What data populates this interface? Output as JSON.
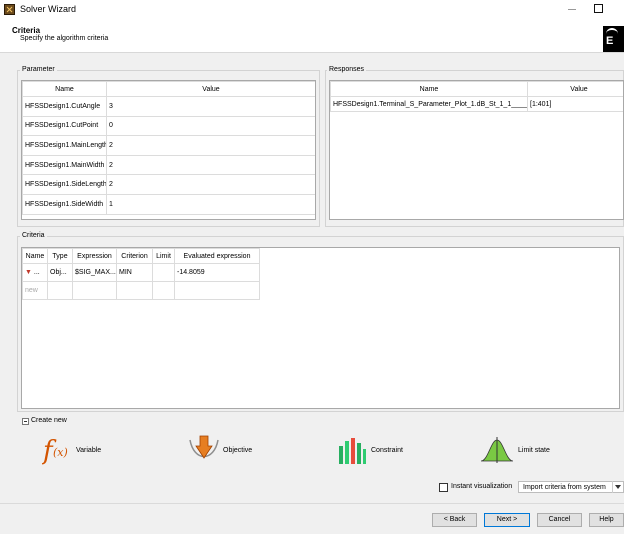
{
  "window": {
    "title": "Solver Wizard"
  },
  "header": {
    "title": "Criteria",
    "subtitle": "Specify the algorithm criteria",
    "logo_text": "E"
  },
  "parameters": {
    "group_title": "Parameter",
    "columns": [
      "Name",
      "Value"
    ],
    "rows": [
      [
        "HFSSDesign1.CutAngle",
        "3"
      ],
      [
        "HFSSDesign1.CutPoint",
        "0"
      ],
      [
        "HFSSDesign1.MainLength",
        "2"
      ],
      [
        "HFSSDesign1.MainWidth",
        "2"
      ],
      [
        "HFSSDesign1.SideLength",
        "2"
      ],
      [
        "HFSSDesign1.SideWidth",
        "1"
      ]
    ]
  },
  "responses": {
    "group_title": "Responses",
    "columns": [
      "Name",
      "Value"
    ],
    "rows": [
      [
        "HFSSDesign1.Terminal_S_Parameter_Plot_1.dB_St_1_1_____",
        "[1:401]"
      ]
    ]
  },
  "criteria": {
    "group_title": "Criteria",
    "columns": [
      "Name",
      "Type",
      "Expression",
      "Criterion",
      "Limit",
      "Evaluated expression"
    ],
    "rows": [
      {
        "name": "...",
        "type": "Obj...",
        "expression": "$SIG_MAX...",
        "criterion": "MIN",
        "limit": "",
        "evaluated": "-14.8059"
      }
    ],
    "new_row_label": "new"
  },
  "create_new": {
    "label": "Create new",
    "types": [
      "Variable",
      "Objective",
      "Constraint",
      "Limit state"
    ]
  },
  "options": {
    "instant_visualization_label": "Instant visualization",
    "instant_visualization_checked": false,
    "import_label": "Import criteria from system"
  },
  "buttons": {
    "back": "< Back",
    "next": "Next >",
    "cancel": "Cancel",
    "help": "Help"
  },
  "colors": {
    "accent": "#0078d7",
    "variable_icon": "#d35400",
    "objective_icon": "#e67e22",
    "constraint_icon": "#27ae60"
  }
}
